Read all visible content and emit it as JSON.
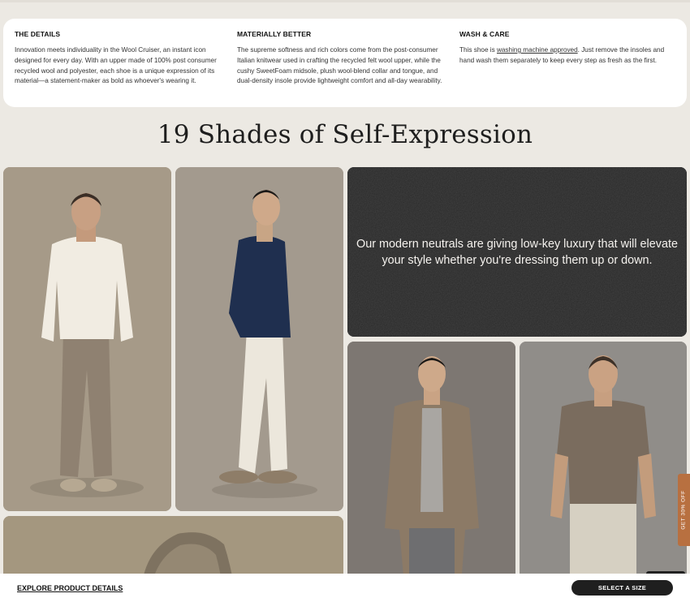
{
  "details": {
    "columns": [
      {
        "heading": "THE DETAILS",
        "text": "Innovation meets individuality in the Wool Cruiser, an instant icon designed for every day. With an upper made of 100% post consumer recycled wool and polyester, each shoe is a unique expression of its material—a statement-maker as bold as whoever's wearing it."
      },
      {
        "heading": "MATERIALLY BETTER",
        "text": "The supreme softness and rich colors come from the post-consumer Italian knitwear used in crafting the recycled felt wool upper, while the cushy SweetFoam midsole, plush wool-blend collar and tongue, and dual-density insole provide lightweight comfort and all-day wearability."
      },
      {
        "heading": "WASH & CARE",
        "text_before": "This shoe is ",
        "link": "washing machine approved",
        "text_after": ". Just remove the insoles and hand wash them separately to keep every step as fresh as the first."
      }
    ]
  },
  "gallery": {
    "heading": "19 Shades of Self-Expression",
    "quote": "Our modern neutrals are giving low-key luxury that will elevate your style whether you're dressing them up or down."
  },
  "promo": {
    "label": "GET 30% OFF"
  },
  "bottom_bar": {
    "explore_label": "EXPLORE PRODUCT DETAILS",
    "size_button_label": "SELECT A SIZE"
  },
  "colors": {
    "page_bg": "#ece9e3",
    "card_bg": "#ffffff",
    "button_bg": "#1f1f1f",
    "promo_bg": "#b87040"
  }
}
